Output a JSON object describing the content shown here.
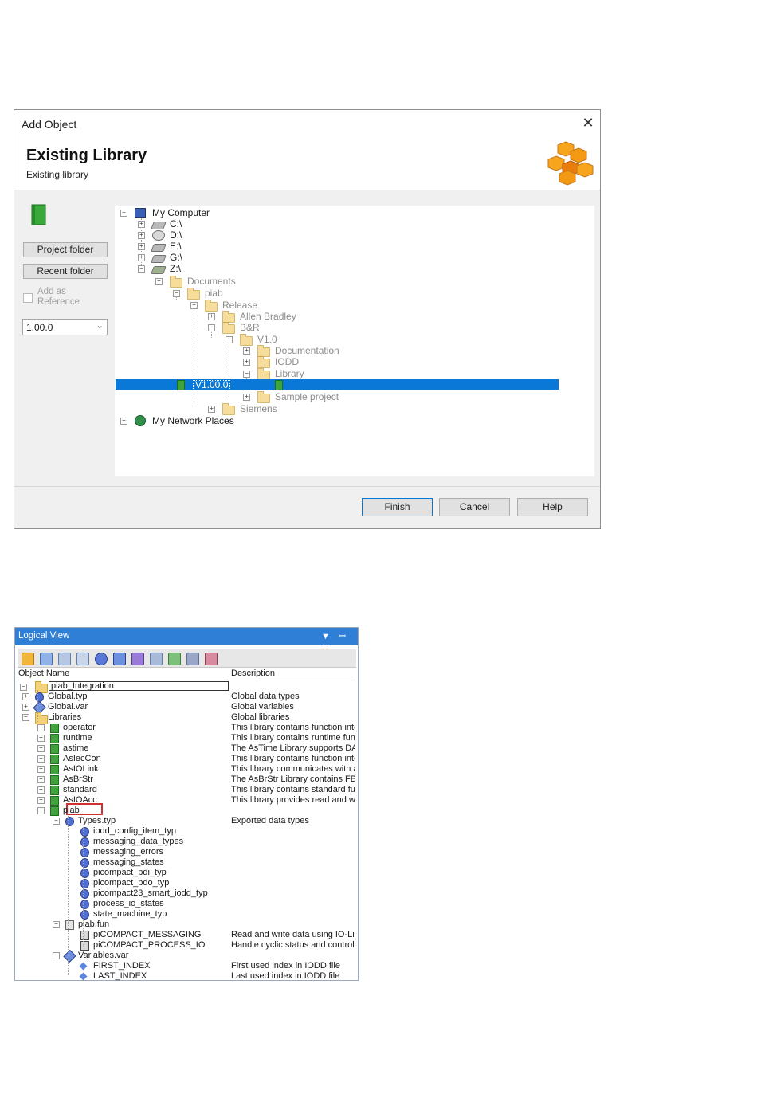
{
  "dialog": {
    "window_title": "Add Object",
    "close_glyph": "✕",
    "heading": "Existing Library",
    "subheading": "Existing library",
    "buttons": {
      "project_folder": "Project folder",
      "recent_folder": "Recent folder",
      "finish": "Finish",
      "cancel": "Cancel",
      "help": "Help"
    },
    "add_as_reference": "Add as Reference",
    "version_select": {
      "value": "1.00.0",
      "chevron": "⌄"
    },
    "tree": [
      {
        "label": "My Computer",
        "icon": "computer-icon",
        "expander": "−"
      },
      {
        "label": "C:\\",
        "icon": "drive-icon",
        "expander": "+"
      },
      {
        "label": "D:\\",
        "icon": "cd-drive-icon",
        "expander": "+"
      },
      {
        "label": "E:\\",
        "icon": "drive-icon",
        "expander": "+"
      },
      {
        "label": "G:\\",
        "icon": "drive-icon",
        "expander": "+"
      },
      {
        "label": "Z:\\",
        "icon": "network-drive-icon",
        "expander": "−"
      },
      {
        "label": "Documents",
        "icon": "folder-icon",
        "expander": "+"
      },
      {
        "label": "piab",
        "icon": "folder-open-icon",
        "expander": "−"
      },
      {
        "label": "Release",
        "icon": "folder-open-icon",
        "expander": "−"
      },
      {
        "label": "Allen Bradley",
        "icon": "folder-icon",
        "expander": "+"
      },
      {
        "label": "B&R",
        "icon": "folder-open-icon",
        "expander": "−"
      },
      {
        "label": "V1.0",
        "icon": "folder-open-icon",
        "expander": "−"
      },
      {
        "label": "Documentation",
        "icon": "folder-icon",
        "expander": "+"
      },
      {
        "label": "IODD",
        "icon": "folder-icon",
        "expander": "+"
      },
      {
        "label": "Library",
        "icon": "folder-open-icon",
        "expander": "−"
      },
      {
        "label": "V1.00.0",
        "icon": "library-icon",
        "expander": ""
      },
      {
        "label": "Sample project",
        "icon": "folder-icon",
        "expander": "+"
      },
      {
        "label": "Siemens",
        "icon": "folder-icon",
        "expander": "+"
      },
      {
        "label": "My Network Places",
        "icon": "network-places-icon",
        "expander": "+"
      }
    ]
  },
  "logical_view": {
    "title": "Logical View",
    "controls": "▼ ꟷ ✕",
    "columns": {
      "name": "Object Name",
      "description": "Description"
    },
    "root": "piab_Integration",
    "rows": [
      {
        "name": "Global.typ",
        "desc": "Global data types"
      },
      {
        "name": "Global.var",
        "desc": "Global variables"
      },
      {
        "name": "Libraries",
        "desc": "Global libraries"
      },
      {
        "name": "operator",
        "desc": "This library contains function inte"
      },
      {
        "name": "runtime",
        "desc": "This library contains runtime func"
      },
      {
        "name": "astime",
        "desc": "The AsTime Library supports DA"
      },
      {
        "name": "AsIecCon",
        "desc": "This library contains function inte"
      },
      {
        "name": "AsIOLink",
        "desc": "This library communicates with a"
      },
      {
        "name": "AsBrStr",
        "desc": "The AsBrStr Library contains FBI"
      },
      {
        "name": "standard",
        "desc": "This library contains standard fur"
      },
      {
        "name": "AsIOAcc",
        "desc": "This library provides read and w"
      },
      {
        "name": "piab",
        "desc": ""
      },
      {
        "name": "Types.typ",
        "desc": "Exported data types"
      },
      {
        "name": "iodd_config_item_typ",
        "desc": ""
      },
      {
        "name": "messaging_data_types",
        "desc": ""
      },
      {
        "name": "messaging_errors",
        "desc": ""
      },
      {
        "name": "messaging_states",
        "desc": ""
      },
      {
        "name": "picompact_pdi_typ",
        "desc": ""
      },
      {
        "name": "picompact_pdo_typ",
        "desc": ""
      },
      {
        "name": "picompact23_smart_iodd_typ",
        "desc": ""
      },
      {
        "name": "process_io_states",
        "desc": ""
      },
      {
        "name": "state_machine_typ",
        "desc": ""
      },
      {
        "name": "piab.fun",
        "desc": ""
      },
      {
        "name": "piCOMPACT_MESSAGING",
        "desc": "Read and write data using IO-Lin"
      },
      {
        "name": "piCOMPACT_PROCESS_IO",
        "desc": "Handle cyclic status and control"
      },
      {
        "name": "Variables.var",
        "desc": ""
      },
      {
        "name": "FIRST_INDEX",
        "desc": "First used index in IODD file"
      },
      {
        "name": "LAST_INDEX",
        "desc": "Last used index in IODD file"
      }
    ]
  }
}
